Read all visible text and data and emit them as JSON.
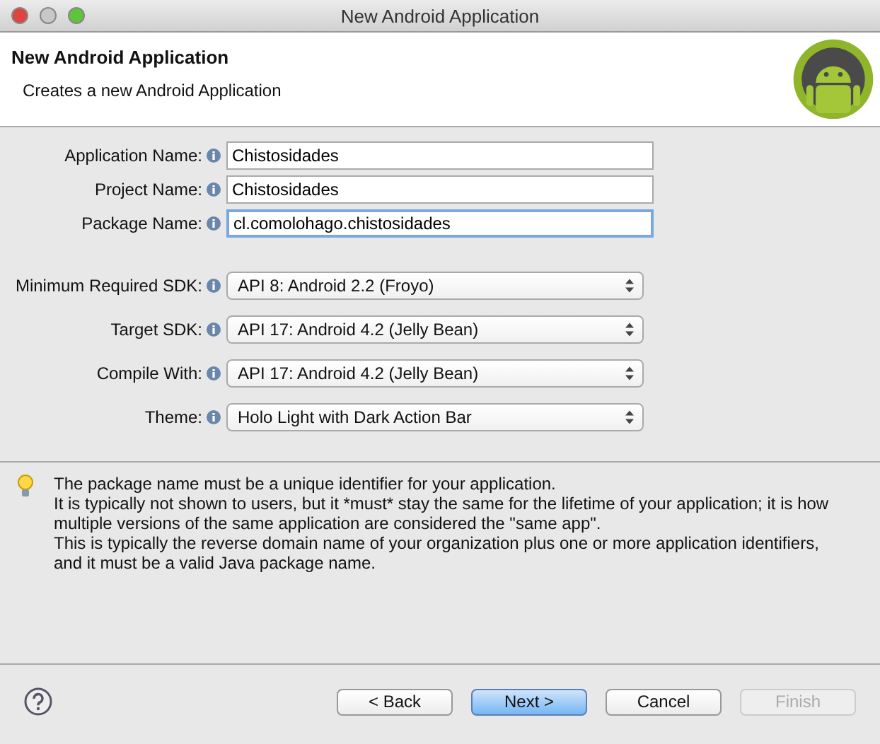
{
  "window": {
    "title": "New Android Application"
  },
  "header": {
    "title": "New Android Application",
    "subtitle": "Creates a new Android Application"
  },
  "fields": [
    {
      "label": "Application Name:",
      "value": "Chistosidades",
      "focused": false
    },
    {
      "label": "Project Name:",
      "value": "Chistosidades",
      "focused": false
    },
    {
      "label": "Package Name:",
      "value": "cl.comolohago.chistosidades",
      "focused": true
    }
  ],
  "selects": [
    {
      "label": "Minimum Required SDK:",
      "value": "API 8: Android 2.2 (Froyo)"
    },
    {
      "label": "Target SDK:",
      "value": "API 17: Android 4.2 (Jelly Bean)"
    },
    {
      "label": "Compile With:",
      "value": "API 17: Android 4.2 (Jelly Bean)"
    },
    {
      "label": "Theme:",
      "value": "Holo Light with Dark Action Bar"
    }
  ],
  "hint": {
    "lines": [
      "The package name must be a unique identifier for your application.",
      "It is typically not shown to users, but it *must* stay the same for the lifetime of your application; it is how",
      "multiple versions of the same application are considered the \"same app\".",
      "This is typically the reverse domain name of your organization plus one or more application identifiers,",
      "and it must be a valid Java package name."
    ]
  },
  "buttons": [
    {
      "label": "< Back",
      "default": false,
      "disabled": false
    },
    {
      "label": "Next >",
      "default": true,
      "disabled": false
    },
    {
      "label": "Cancel",
      "default": false,
      "disabled": false
    },
    {
      "label": "Finish",
      "default": false,
      "disabled": true
    }
  ]
}
